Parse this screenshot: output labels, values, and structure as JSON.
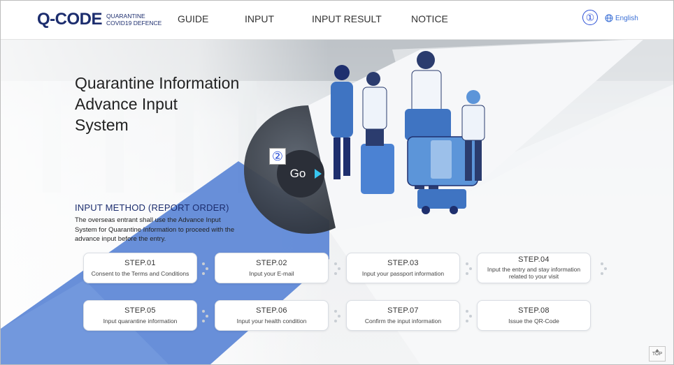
{
  "header": {
    "logo_main": "Q-CODE",
    "logo_sub_line1": "QUARANTINE",
    "logo_sub_line2": "COVID19 DEFENCE",
    "nav": [
      "GUIDE",
      "INPUT",
      "INPUT RESULT",
      "NOTICE"
    ],
    "language": "English",
    "marker": "①"
  },
  "hero": {
    "title_line1": "Quarantine Information",
    "title_line2": "Advance Input",
    "title_line3": "System",
    "go_label": "Go",
    "marker": "②"
  },
  "method": {
    "title": "INPUT METHOD (REPORT ORDER)",
    "description": "The overseas entrant shall use the Advance Input System for Quarantine Information to proceed with the advance input before the entry."
  },
  "steps": [
    {
      "title": "STEP.01",
      "desc": "Consent to the Terms and Conditions"
    },
    {
      "title": "STEP.02",
      "desc": "Input your E-mail"
    },
    {
      "title": "STEP.03",
      "desc": "Input your passport information"
    },
    {
      "title": "STEP.04",
      "desc": "Input the entry and stay information related to your visit"
    },
    {
      "title": "STEP.05",
      "desc": "Input quarantine information"
    },
    {
      "title": "STEP.06",
      "desc": "Input your health condition"
    },
    {
      "title": "STEP.07",
      "desc": "Confirm the input information"
    },
    {
      "title": "STEP.08",
      "desc": "Issue the QR-Code"
    }
  ],
  "top_button": "TOP",
  "colors": {
    "brand": "#1c2d6e",
    "accent_blue": "#5b86d6",
    "link": "#3a6fd6",
    "go_arrow": "#37c6f0"
  }
}
